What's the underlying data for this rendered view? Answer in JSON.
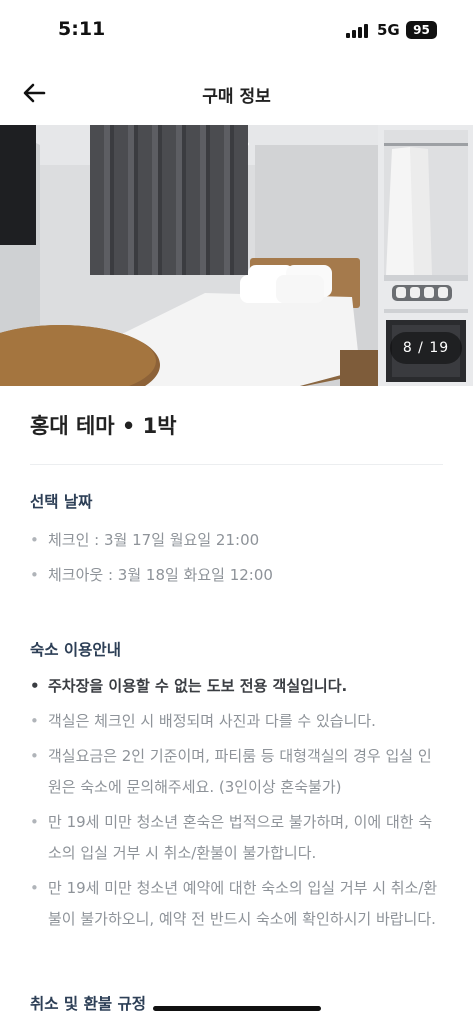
{
  "status_bar": {
    "time": "5:11",
    "network": "5G",
    "battery": "95"
  },
  "header": {
    "title": "구매 정보",
    "back_icon": "arrow-left-icon"
  },
  "photo": {
    "counter": "8 / 19"
  },
  "product": {
    "title": "홍대 테마 • 1박"
  },
  "selected_dates": {
    "heading": "선택 날짜",
    "items": [
      "체크인 : 3월 17일 월요일 21:00",
      "체크아웃 : 3월 18일 화요일 12:00"
    ]
  },
  "lodging_guide": {
    "heading": "숙소 이용안내",
    "items": [
      "주차장을 이용할 수 없는 도보 전용 객실입니다.",
      "객실은 체크인 시 배정되며 사진과 다를 수 있습니다.",
      "객실요금은 2인 기준이며, 파티룸 등 대형객실의 경우 입실 인원은 숙소에 문의해주세요. (3인이상 혼숙불가)",
      "만 19세 미만 청소년 혼숙은 법적으로 불가하며, 이에 대한 숙소의 입실 거부 시 취소/환불이 불가합니다.",
      "만 19세 미만 청소년 예약에 대한 숙소의 입실 거부 시 취소/환불이 불가하오니, 예약 전 반드시 숙소에 확인하시기 바랍니다."
    ]
  },
  "cancellation": {
    "heading": "취소 및 환불 규정"
  }
}
